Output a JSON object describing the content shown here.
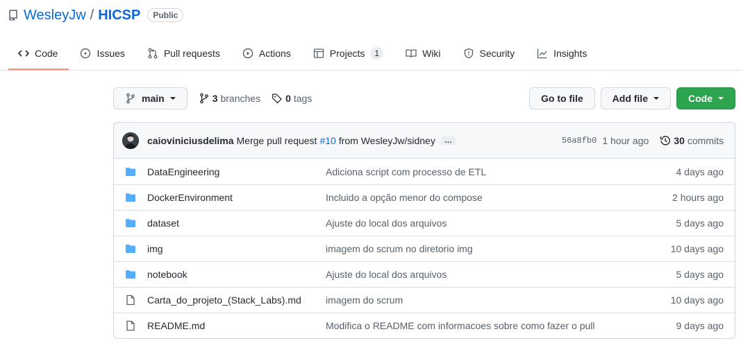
{
  "repo": {
    "owner": "WesleyJw",
    "separator": "/",
    "name": "HICSP",
    "visibility": "Public"
  },
  "tabs": [
    {
      "label": "Code",
      "icon": "code-icon",
      "active": true
    },
    {
      "label": "Issues",
      "icon": "issue-icon"
    },
    {
      "label": "Pull requests",
      "icon": "pull-request-icon"
    },
    {
      "label": "Actions",
      "icon": "play-icon"
    },
    {
      "label": "Projects",
      "icon": "table-icon",
      "count": "1"
    },
    {
      "label": "Wiki",
      "icon": "book-icon"
    },
    {
      "label": "Security",
      "icon": "shield-icon"
    },
    {
      "label": "Insights",
      "icon": "graph-icon"
    }
  ],
  "toolbar": {
    "branch": "main",
    "branches_count": "3",
    "branches_label": "branches",
    "tags_count": "0",
    "tags_label": "tags",
    "go_to_file": "Go to file",
    "add_file": "Add file",
    "code": "Code"
  },
  "commit": {
    "author": "caioviniciusdelima",
    "message_start": "Merge pull request",
    "pr_link": "#10",
    "message_end": "from WesleyJw/sidney",
    "ellipsis": "…",
    "sha": "56a8fb0",
    "time": "1 hour ago",
    "count": "30",
    "count_label": "commits"
  },
  "files": [
    {
      "type": "folder",
      "name": "DataEngineering",
      "message": "Adiciona script com processo de ETL",
      "age": "4 days ago"
    },
    {
      "type": "folder",
      "name": "DockerEnvironment",
      "message": "Incluido a opção menor do compose",
      "age": "2 hours ago"
    },
    {
      "type": "folder",
      "name": "dataset",
      "message": "Ajuste do local dos arquivos",
      "age": "5 days ago"
    },
    {
      "type": "folder",
      "name": "img",
      "message": "imagem do scrum no diretorio img",
      "age": "10 days ago"
    },
    {
      "type": "folder",
      "name": "notebook",
      "message": "Ajuste do local dos arquivos",
      "age": "5 days ago"
    },
    {
      "type": "file",
      "name": "Carta_do_projeto_(Stack_Labs).md",
      "message": "imagem do scrum",
      "age": "10 days ago"
    },
    {
      "type": "file",
      "name": "README.md",
      "message": "Modifica o README com informacoes sobre como fazer o pull",
      "age": "9 days ago"
    }
  ],
  "colors": {
    "link": "#0969da",
    "folder": "#54aeff",
    "code_button": "#2da44e",
    "active_tab_underline": "#fd8c73"
  }
}
